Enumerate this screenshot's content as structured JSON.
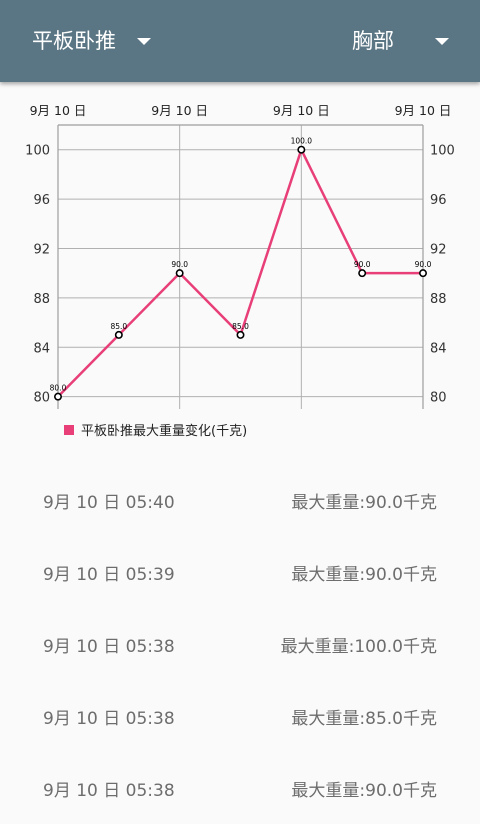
{
  "toolbar": {
    "exercise_select": "平板卧推",
    "bodypart_select": "胸部"
  },
  "chart_data": {
    "type": "line",
    "x": [
      "9月 10 日",
      "9月 10 日",
      "9月 10 日",
      "9月 10 日",
      "9月 10 日",
      "9月 10 日",
      "9月 10 日"
    ],
    "series": [
      {
        "name": "平板卧推最大重量变化(千克)",
        "values": [
          80.0,
          85.0,
          90.0,
          85.0,
          100.0,
          90.0,
          90.0
        ],
        "point_labels": [
          "80.0",
          "85.0",
          "90.0",
          "85.0",
          "100.0",
          "90.0",
          "90.0"
        ],
        "color": "#e83f78"
      }
    ],
    "x_tick_labels": [
      "9月 10 日",
      "9月 10 日",
      "9月 10 日",
      "9月 10 日"
    ],
    "y_ticks": [
      "80",
      "84",
      "88",
      "92",
      "96",
      "100"
    ],
    "ylim": [
      79,
      102
    ],
    "grid": true,
    "legend": "bottom-left",
    "axis_color": "#9e9e9e"
  },
  "records": [
    {
      "time": "9月 10 日 05:40",
      "value": "最大重量:90.0千克"
    },
    {
      "time": "9月 10 日 05:39",
      "value": "最大重量:90.0千克"
    },
    {
      "time": "9月 10 日 05:38",
      "value": "最大重量:100.0千克"
    },
    {
      "time": "9月 10 日 05:38",
      "value": "最大重量:85.0千克"
    },
    {
      "time": "9月 10 日 05:38",
      "value": "最大重量:90.0千克"
    }
  ]
}
